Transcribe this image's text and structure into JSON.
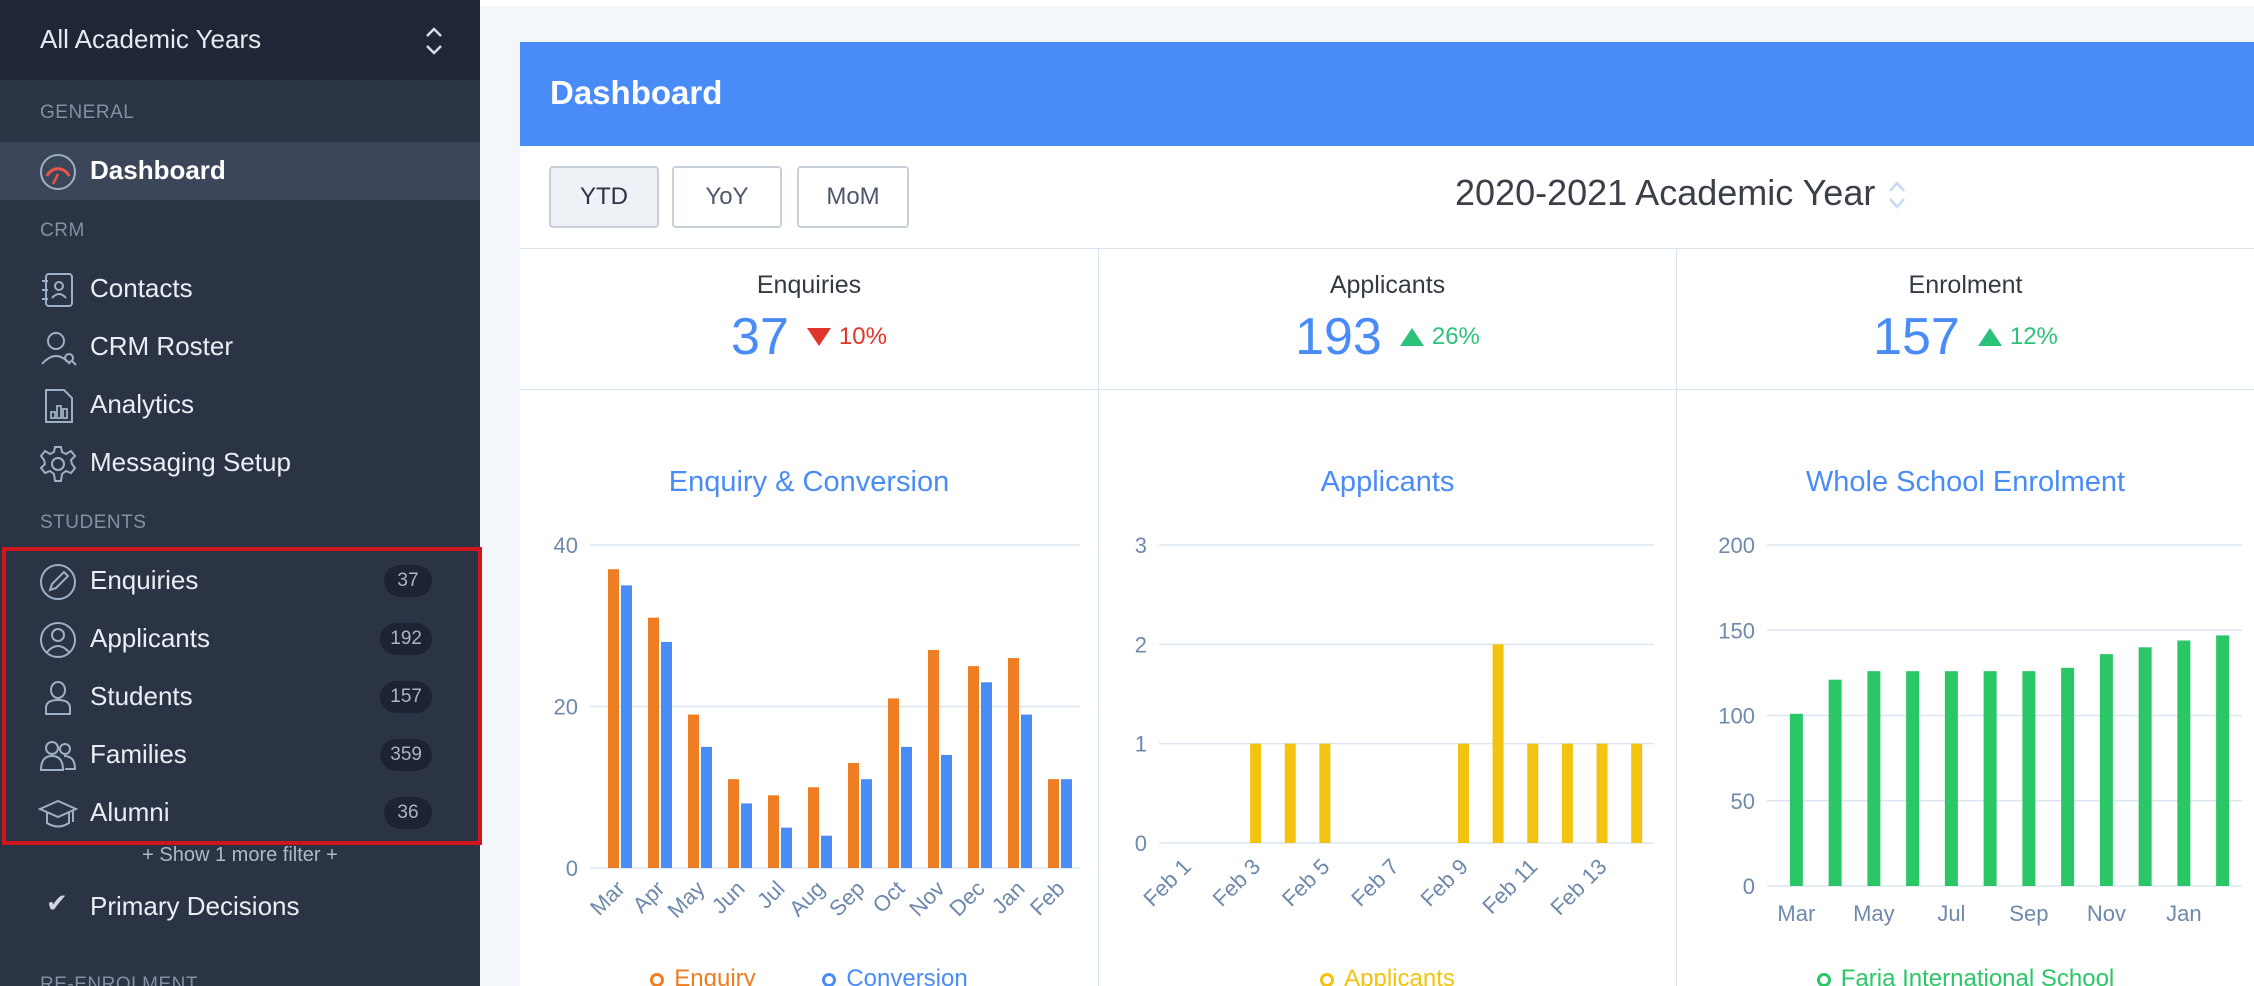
{
  "sidebar": {
    "year_selector": "All Academic Years",
    "sections": {
      "general": "GENERAL",
      "crm": "CRM",
      "students": "STUDENTS",
      "reenrolment": "RE-ENROLMENT"
    },
    "items": [
      {
        "label": "Dashboard",
        "icon": "dashboard-gauge-icon",
        "active": true
      },
      {
        "label": "Contacts",
        "icon": "contacts-book-icon"
      },
      {
        "label": "CRM Roster",
        "icon": "roster-person-icon"
      },
      {
        "label": "Analytics",
        "icon": "analytics-chart-icon"
      },
      {
        "label": "Messaging Setup",
        "icon": "gear-icon"
      },
      {
        "label": "Enquiries",
        "icon": "pencil-circle-icon",
        "count": "37"
      },
      {
        "label": "Applicants",
        "icon": "person-circle-icon",
        "count": "192"
      },
      {
        "label": "Students",
        "icon": "student-person-icon",
        "count": "157"
      },
      {
        "label": "Families",
        "icon": "family-people-icon",
        "count": "359"
      },
      {
        "label": "Alumni",
        "icon": "graduation-cap-icon",
        "count": "36"
      }
    ],
    "show_more": "+ Show 1 more filter +",
    "primary_decisions": "Primary Decisions"
  },
  "dashboard": {
    "title": "Dashboard",
    "period_buttons": [
      "YTD",
      "YoY",
      "MoM"
    ],
    "active_period": "YTD",
    "academic_year": "2020-2021 Academic Year"
  },
  "stats": [
    {
      "label": "Enquiries",
      "value": "37",
      "change": "10%",
      "direction": "down"
    },
    {
      "label": "Applicants",
      "value": "193",
      "change": "26%",
      "direction": "up"
    },
    {
      "label": "Enrolment",
      "value": "157",
      "change": "12%",
      "direction": "up"
    }
  ],
  "colors": {
    "accent": "#4a8cf7",
    "enquiry": "#ef7d22",
    "conversion": "#4a8cf7",
    "applicants": "#f2c40f",
    "enrolment": "#2bc766",
    "down": "#e0352b",
    "up": "#2bc27a"
  },
  "chart_data": [
    {
      "type": "bar",
      "title": "Enquiry & Conversion",
      "categories": [
        "Mar",
        "Apr",
        "May",
        "Jun",
        "Jul",
        "Aug",
        "Sep",
        "Oct",
        "Nov",
        "Dec",
        "Jan",
        "Feb"
      ],
      "series": [
        {
          "name": "Enquiry",
          "values": [
            37,
            31,
            19,
            11,
            9,
            10,
            13,
            21,
            27,
            25,
            26,
            11
          ]
        },
        {
          "name": "Conversion",
          "values": [
            35,
            28,
            15,
            8,
            5,
            4,
            11,
            15,
            14,
            23,
            19,
            11
          ]
        }
      ],
      "ylim": [
        0,
        40
      ],
      "yticks": [
        "0",
        "20",
        "40"
      ],
      "grid": true,
      "legend": "bottom"
    },
    {
      "type": "bar",
      "title": "Applicants",
      "categories": [
        "Feb 1",
        "Feb 2",
        "Feb 3",
        "Feb 4",
        "Feb 5",
        "Feb 6",
        "Feb 7",
        "Feb 8",
        "Feb 9",
        "Feb 10",
        "Feb 11",
        "Feb 12",
        "Feb 13",
        "Feb 14"
      ],
      "tick_labels": [
        "Feb 1",
        "Feb 3",
        "Feb 5",
        "Feb 7",
        "Feb 9",
        "Feb 11",
        "Feb 13"
      ],
      "series": [
        {
          "name": "Applicants",
          "values": [
            0,
            0,
            1,
            1,
            1,
            0,
            0,
            0,
            1,
            2,
            1,
            1,
            1,
            1
          ]
        }
      ],
      "ylim": [
        0,
        3
      ],
      "yticks": [
        "0",
        "1",
        "2",
        "3"
      ],
      "grid": true,
      "legend": "bottom"
    },
    {
      "type": "bar",
      "title": "Whole School Enrolment",
      "categories": [
        "Mar",
        "Apr",
        "May",
        "Jun",
        "Jul",
        "Aug",
        "Sep",
        "Oct",
        "Nov",
        "Dec",
        "Jan",
        "Feb"
      ],
      "tick_labels": [
        "Mar",
        "May",
        "Jul",
        "Sep",
        "Nov",
        "Jan"
      ],
      "series": [
        {
          "name": "Faria International School",
          "values": [
            101,
            121,
            126,
            126,
            126,
            126,
            126,
            128,
            136,
            140,
            144,
            147
          ]
        }
      ],
      "ylim": [
        0,
        200
      ],
      "yticks": [
        "0",
        "50",
        "100",
        "150",
        "200"
      ],
      "grid": true,
      "legend": "bottom"
    }
  ]
}
